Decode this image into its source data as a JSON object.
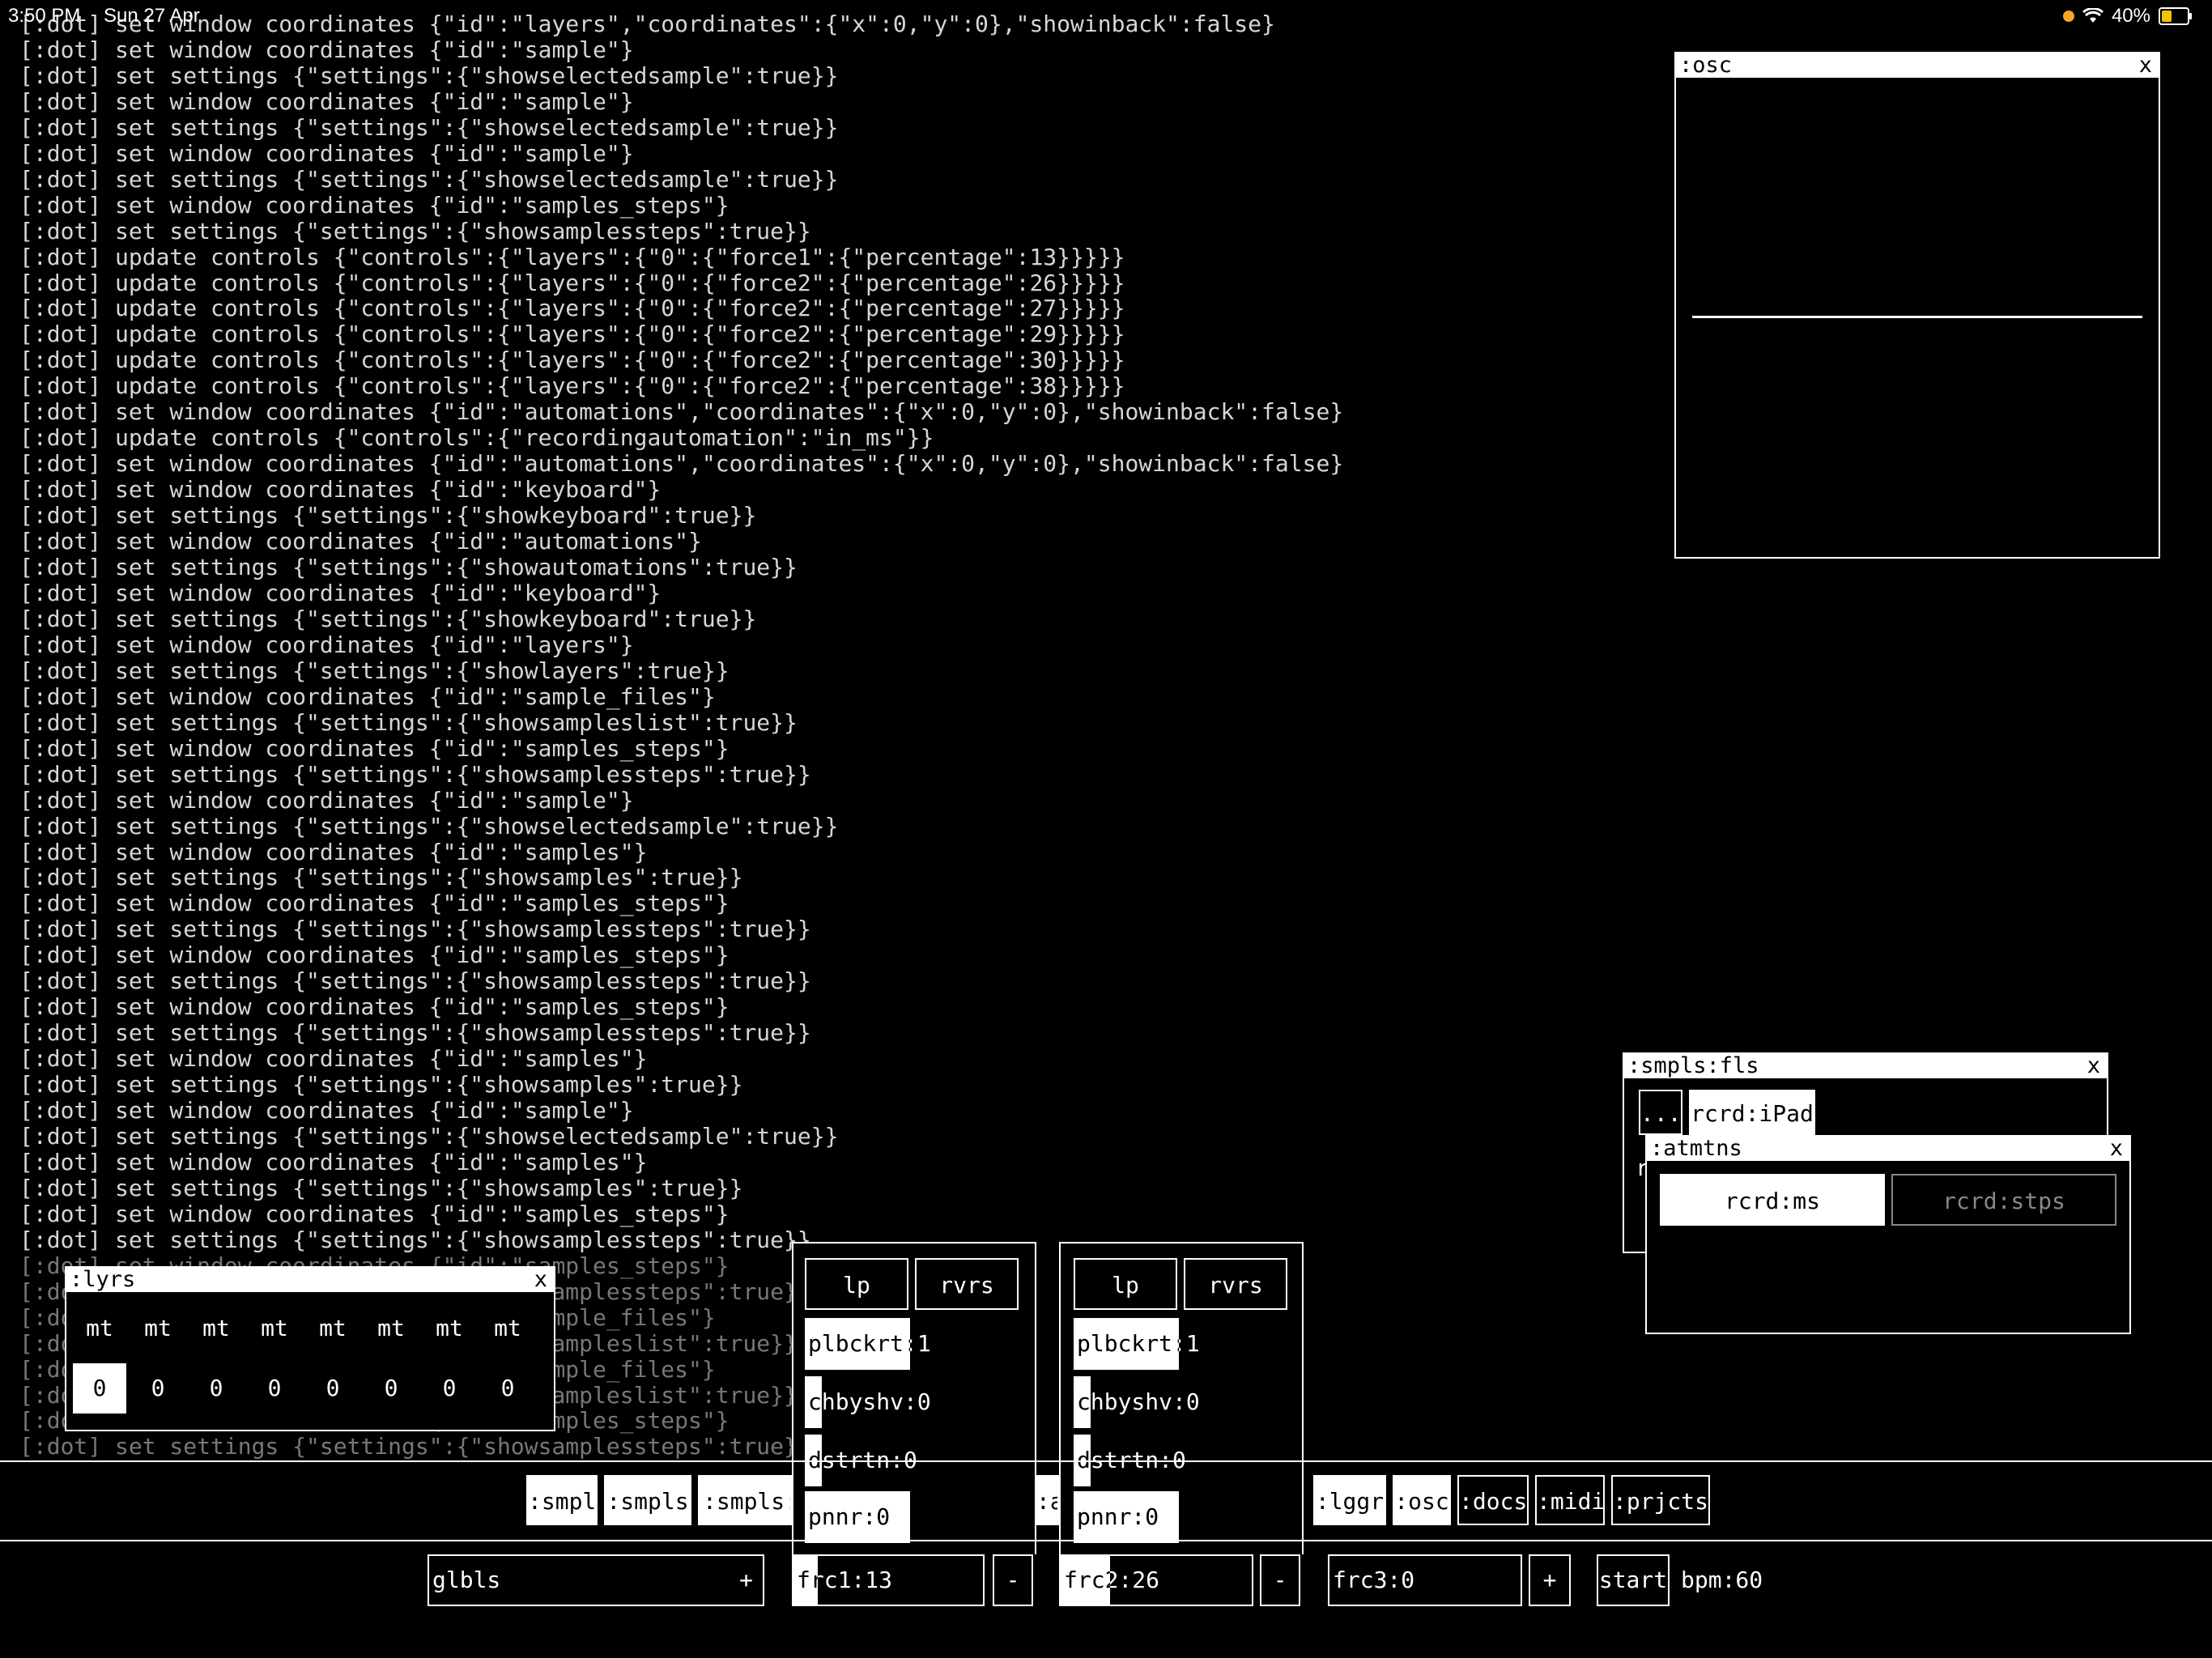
{
  "status": {
    "time": "3:50 PM",
    "date": "Sun 27 Apr",
    "battery": "40%"
  },
  "log": [
    "[:dot] set window coordinates {\"id\":\"layers\",\"coordinates\":{\"x\":0,\"y\":0},\"showinback\":false}",
    "[:dot] set window coordinates {\"id\":\"sample\"}",
    "[:dot] set settings {\"settings\":{\"showselectedsample\":true}}",
    "[:dot] set window coordinates {\"id\":\"sample\"}",
    "[:dot] set settings {\"settings\":{\"showselectedsample\":true}}",
    "[:dot] set window coordinates {\"id\":\"sample\"}",
    "[:dot] set settings {\"settings\":{\"showselectedsample\":true}}",
    "[:dot] set window coordinates {\"id\":\"samples_steps\"}",
    "[:dot] set settings {\"settings\":{\"showsamplessteps\":true}}",
    "[:dot] update controls {\"controls\":{\"layers\":{\"0\":{\"force1\":{\"percentage\":13}}}}}",
    "[:dot] update controls {\"controls\":{\"layers\":{\"0\":{\"force2\":{\"percentage\":26}}}}}",
    "[:dot] update controls {\"controls\":{\"layers\":{\"0\":{\"force2\":{\"percentage\":27}}}}}",
    "[:dot] update controls {\"controls\":{\"layers\":{\"0\":{\"force2\":{\"percentage\":29}}}}}",
    "[:dot] update controls {\"controls\":{\"layers\":{\"0\":{\"force2\":{\"percentage\":30}}}}}",
    "[:dot] update controls {\"controls\":{\"layers\":{\"0\":{\"force2\":{\"percentage\":38}}}}}",
    "[:dot] set window coordinates {\"id\":\"automations\",\"coordinates\":{\"x\":0,\"y\":0},\"showinback\":false}",
    "[:dot] update controls {\"controls\":{\"recordingautomation\":\"in_ms\"}}",
    "[:dot] set window coordinates {\"id\":\"automations\",\"coordinates\":{\"x\":0,\"y\":0},\"showinback\":false}",
    "[:dot] set window coordinates {\"id\":\"keyboard\"}",
    "[:dot] set settings {\"settings\":{\"showkeyboard\":true}}",
    "[:dot] set window coordinates {\"id\":\"automations\"}",
    "[:dot] set settings {\"settings\":{\"showautomations\":true}}",
    "[:dot] set window coordinates {\"id\":\"keyboard\"}",
    "[:dot] set settings {\"settings\":{\"showkeyboard\":true}}",
    "[:dot] set window coordinates {\"id\":\"layers\"}",
    "[:dot] set settings {\"settings\":{\"showlayers\":true}}",
    "[:dot] set window coordinates {\"id\":\"sample_files\"}",
    "[:dot] set settings {\"settings\":{\"showsampleslist\":true}}",
    "[:dot] set window coordinates {\"id\":\"samples_steps\"}",
    "[:dot] set settings {\"settings\":{\"showsamplessteps\":true}}",
    "[:dot] set window coordinates {\"id\":\"sample\"}",
    "[:dot] set settings {\"settings\":{\"showselectedsample\":true}}",
    "[:dot] set window coordinates {\"id\":\"samples\"}",
    "[:dot] set settings {\"settings\":{\"showsamples\":true}}",
    "[:dot] set window coordinates {\"id\":\"samples_steps\"}",
    "[:dot] set settings {\"settings\":{\"showsamplessteps\":true}}",
    "[:dot] set window coordinates {\"id\":\"samples_steps\"}",
    "[:dot] set settings {\"settings\":{\"showsamplessteps\":true}}",
    "[:dot] set window coordinates {\"id\":\"samples_steps\"}",
    "[:dot] set settings {\"settings\":{\"showsamplessteps\":true}}",
    "[:dot] set window coordinates {\"id\":\"samples\"}",
    "[:dot] set settings {\"settings\":{\"showsamples\":true}}",
    "[:dot] set window coordinates {\"id\":\"sample\"}",
    "[:dot] set settings {\"settings\":{\"showselectedsample\":true}}",
    "[:dot] set window coordinates {\"id\":\"samples\"}",
    "[:dot] set settings {\"settings\":{\"showsamples\":true}}",
    "[:dot] set window coordinates {\"id\":\"samples_steps\"}",
    "[:dot] set settings {\"settings\":{\"showsamplessteps\":true}}",
    "[:dot] set window coordinates {\"id\":\"samples_steps\"}",
    "[:dot] set settings {\"settings\":{\"showsamplessteps\":true}}",
    "[:dot] set window coordinates {\"id\":\"sample_files\"}",
    "[:dot] set settings {\"settings\":{\"showsampleslist\":true}}",
    "[:dot] set window coordinates {\"id\":\"sample_files\"}",
    "[:dot] set settings {\"settings\":{\"showsampleslist\":true}}",
    "[:dot] set window coordinates {\"id\":\"samples_steps\"}",
    "[:dot] set settings {\"settings\":{\"showsamplessteps\":true}}"
  ],
  "osc": {
    "title": ":osc",
    "close": "x"
  },
  "smpls_fls": {
    "title": ":smpls:fls",
    "close": "x",
    "up": "...",
    "record": "rcrd:iPad",
    "hidden_item": "r"
  },
  "atmtns": {
    "title": ":atmtns",
    "close": "x",
    "rcrd_ms": "rcrd:ms",
    "rcrd_stps": "rcrd:stps"
  },
  "lyrs": {
    "title": ":lyrs",
    "close": "x",
    "mute_labels": [
      "mt",
      "mt",
      "mt",
      "mt",
      "mt",
      "mt",
      "mt",
      "mt"
    ],
    "values": [
      "0",
      "0",
      "0",
      "0",
      "0",
      "0",
      "0",
      "0"
    ]
  },
  "panel1": {
    "lp": "lp",
    "rvrs": "rvrs",
    "playback": "plbckrt:1",
    "chbyshv": "chbyshv:0",
    "dstrtn": "dstrtn:0",
    "pnnr": "pnnr:0"
  },
  "panel2": {
    "lp": "lp",
    "rvrs": "rvrs",
    "playback": "plbckrt:1",
    "chbyshv": "chbyshv:0",
    "dstrtn": "dstrtn:0",
    "pnnr": "pnnr:0"
  },
  "toolbar": {
    "smpl": ":smpl",
    "smpls": ":smpls",
    "smpls_partial": ":smpls:",
    "a_partial": ":a",
    "lggr": ":lggr",
    "osc": ":osc",
    "docs": ":docs",
    "midi": ":midi",
    "prjcts": ":prjcts"
  },
  "bottom": {
    "glbls": "glbls",
    "glbls_plus": "+",
    "frc1": "frc1:13",
    "frc1_minus": "-",
    "frc2": "frc2:26",
    "frc2_minus": "-",
    "frc3": "frc3:0",
    "frc3_plus": "+",
    "start": "start",
    "bpm": "bpm:60"
  },
  "levels": {
    "plbckrt": 0.5,
    "chbyshv": 0.08,
    "dstrtn": 0.08,
    "pnnr": 0.5,
    "frc1": 0.13,
    "frc2": 0.26,
    "frc3": 0.0
  }
}
